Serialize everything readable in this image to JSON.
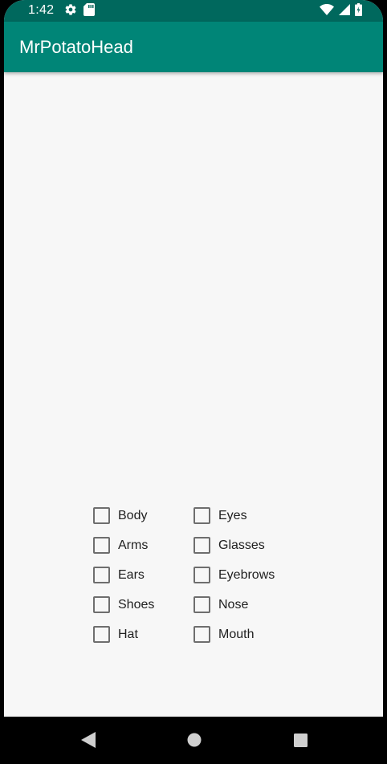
{
  "status_bar": {
    "time": "1:42",
    "icons_left": [
      "gear-icon",
      "sd-card-icon"
    ],
    "icons_right": [
      "wifi-icon",
      "signal-icon",
      "battery-icon"
    ],
    "color": "#00685d"
  },
  "app_bar": {
    "title": "MrPotatoHead",
    "color": "#008577"
  },
  "checkboxes": {
    "left": [
      {
        "label": "Body",
        "checked": false
      },
      {
        "label": "Arms",
        "checked": false
      },
      {
        "label": "Ears",
        "checked": false
      },
      {
        "label": "Shoes",
        "checked": false
      },
      {
        "label": "Hat",
        "checked": false
      }
    ],
    "right": [
      {
        "label": "Eyes",
        "checked": false
      },
      {
        "label": "Glasses",
        "checked": false
      },
      {
        "label": "Eyebrows",
        "checked": false
      },
      {
        "label": "Nose",
        "checked": false
      },
      {
        "label": "Mouth",
        "checked": false
      }
    ]
  },
  "nav_bar": {
    "buttons": [
      "back-icon",
      "home-icon",
      "recents-icon"
    ]
  }
}
